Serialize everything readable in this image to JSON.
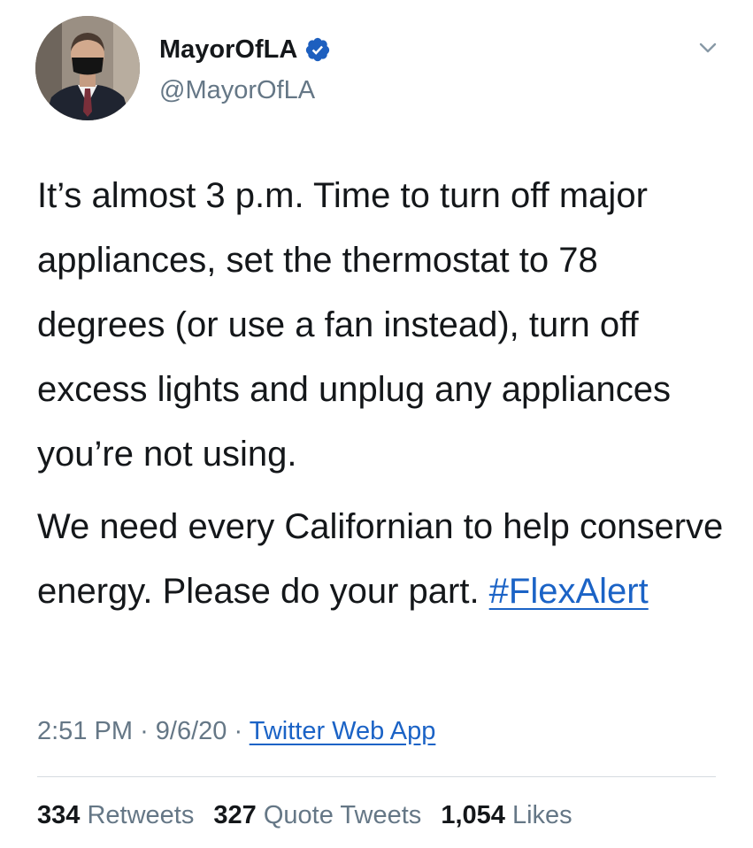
{
  "author": {
    "display_name": "MayorOfLA",
    "handle": "@MayorOfLA",
    "verified": true
  },
  "tweet": {
    "paragraph1": "It’s almost 3 p.m. Time to turn off major appliances, set the thermostat to 78 degrees (or use a fan instead), turn off excess lights and unplug any appliances you’re not using.",
    "paragraph2_text": "We need every Californian to help conserve energy. Please do your part. ",
    "hashtag": "#FlexAlert"
  },
  "meta": {
    "time": "2:51 PM",
    "separator": "·",
    "date": "9/6/20",
    "source": "Twitter Web App"
  },
  "stats": {
    "retweets_count": "334",
    "retweets_label": "Retweets",
    "quotes_count": "327",
    "quotes_label": "Quote Tweets",
    "likes_count": "1,054",
    "likes_label": "Likes"
  },
  "icons": {
    "verified": "verified-badge-icon",
    "menu": "chevron-down-icon"
  },
  "colors": {
    "link": "#1b63c6",
    "secondary_text": "#657786",
    "primary_text": "#14171a",
    "verified_badge": "#1d5fbf"
  }
}
